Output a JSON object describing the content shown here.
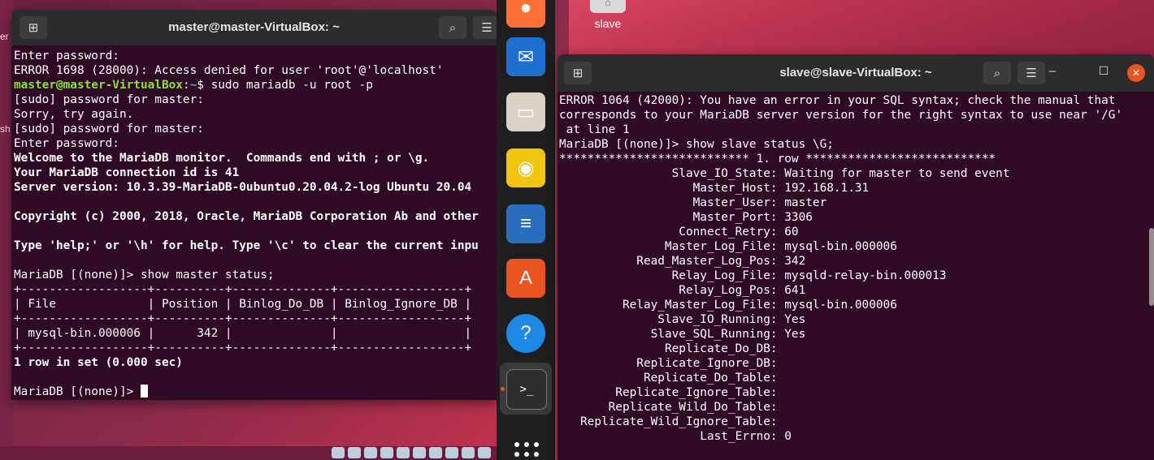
{
  "desktop": {
    "icons": [
      {
        "label": "slave"
      }
    ],
    "edge_labels": [
      "er",
      "sh"
    ]
  },
  "master_terminal": {
    "title": "master@master-VirtualBox: ~",
    "search_icon": "search-icon",
    "menu_icon": "hamburger-menu-icon",
    "lines": [
      {
        "text": "Enter password:",
        "style": "plain"
      },
      {
        "text": "ERROR 1698 (28000): Access denied for user 'root'@'localhost'",
        "style": "plain"
      },
      {
        "text": "",
        "style": "prompt",
        "user": "master@master-VirtualBox",
        "sep": ":",
        "path": "~",
        "cmd": "$ sudo mariadb -u root -p"
      },
      {
        "text": "[sudo] password for master:",
        "style": "plain"
      },
      {
        "text": "Sorry, try again.",
        "style": "plain"
      },
      {
        "text": "[sudo] password for master:",
        "style": "plain"
      },
      {
        "text": "Enter password:",
        "style": "plain"
      },
      {
        "text": "Welcome to the MariaDB monitor.  Commands end with ; or \\g.",
        "style": "bold"
      },
      {
        "text": "Your MariaDB connection id is 41",
        "style": "bold"
      },
      {
        "text": "Server version: 10.3.39-MariaDB-0ubuntu0.20.04.2-log Ubuntu 20.04",
        "style": "bold"
      },
      {
        "text": "",
        "style": "plain"
      },
      {
        "text": "Copyright (c) 2000, 2018, Oracle, MariaDB Corporation Ab and other",
        "style": "bold"
      },
      {
        "text": "",
        "style": "plain"
      },
      {
        "text": "Type 'help;' or '\\h' for help. Type '\\c' to clear the current inpu",
        "style": "bold"
      },
      {
        "text": "",
        "style": "plain"
      },
      {
        "text": "MariaDB [(none)]> show master status;",
        "style": "plain"
      },
      {
        "text": "+------------------+----------+--------------+------------------+",
        "style": "plain"
      },
      {
        "text": "| File             | Position | Binlog_Do_DB | Binlog_Ignore_DB |",
        "style": "plain"
      },
      {
        "text": "+------------------+----------+--------------+------------------+",
        "style": "plain"
      },
      {
        "text": "| mysql-bin.000006 |      342 |              |                  |",
        "style": "plain"
      },
      {
        "text": "+------------------+----------+--------------+------------------+",
        "style": "plain"
      },
      {
        "text": "1 row in set (0.000 sec)",
        "style": "bold"
      },
      {
        "text": "",
        "style": "plain"
      },
      {
        "text": "MariaDB [(none)]> ",
        "style": "cursor"
      }
    ]
  },
  "slave_terminal": {
    "title": "slave@slave-VirtualBox: ~",
    "minimize": "–",
    "maximize": "☐",
    "close": "✕",
    "lines": [
      "ERROR 1064 (42000): You have an error in your SQL syntax; check the manual that",
      "corresponds to your MariaDB server version for the right syntax to use near '/G'",
      " at line 1",
      "MariaDB [(none)]> show slave status \\G;",
      "*************************** 1. row ***************************",
      "                Slave_IO_State: Waiting for master to send event",
      "                   Master_Host: 192.168.1.31",
      "                   Master_User: master",
      "                   Master_Port: 3306",
      "                 Connect_Retry: 60",
      "               Master_Log_File: mysql-bin.000006",
      "           Read_Master_Log_Pos: 342",
      "                Relay_Log_File: mysqld-relay-bin.000013",
      "                 Relay_Log_Pos: 641",
      "         Relay_Master_Log_File: mysql-bin.000006",
      "              Slave_IO_Running: Yes",
      "             Slave_SQL_Running: Yes",
      "               Replicate_Do_DB:",
      "           Replicate_Ignore_DB:",
      "            Replicate_Do_Table:",
      "        Replicate_Ignore_Table:",
      "       Replicate_Wild_Do_Table:",
      "   Replicate_Wild_Ignore_Table:",
      "                    Last_Errno: 0"
    ]
  },
  "dock": {
    "items": [
      {
        "name": "firefox-icon",
        "glyph": "●",
        "color": "#ff7139"
      },
      {
        "name": "thunderbird-icon",
        "glyph": "✉",
        "color": "#1f6fd1"
      },
      {
        "name": "files-icon",
        "glyph": "▭",
        "color": "#d9d2c5"
      },
      {
        "name": "rhythmbox-icon",
        "glyph": "◉",
        "color": "#f1c40f"
      },
      {
        "name": "libreoffice-writer-icon",
        "glyph": "≡",
        "color": "#2a6fbd"
      },
      {
        "name": "software-center-icon",
        "glyph": "A",
        "color": "#e95420"
      },
      {
        "name": "help-icon",
        "glyph": "?",
        "color": "#1e88e5"
      },
      {
        "name": "terminal-icon",
        "glyph": ">_",
        "color": "#2d2d2d"
      }
    ]
  }
}
